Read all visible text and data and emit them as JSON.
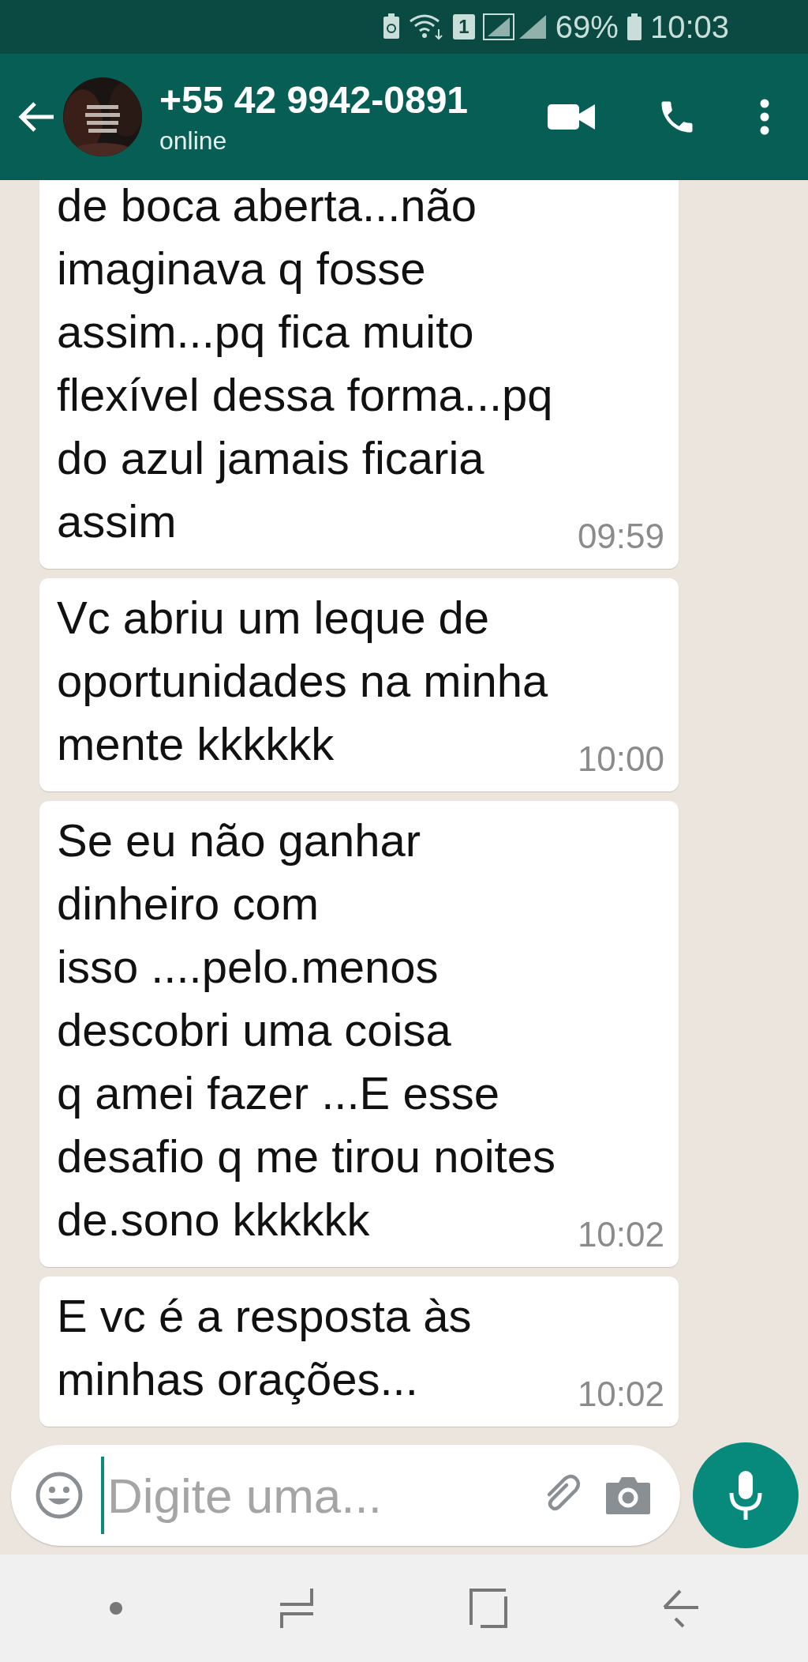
{
  "status_bar": {
    "sim_label": "1",
    "battery": "69%",
    "time": "10:03"
  },
  "header": {
    "contact": "+55 42 9942-0891",
    "presence": "online"
  },
  "messages": [
    {
      "kind": "continued",
      "text": "de boca aberta...não\nimaginava q fosse\nassim...pq fica muito\nflexível dessa forma...pq\ndo azul jamais ficaria\nassim",
      "time": "09:59"
    },
    {
      "kind": "full",
      "text": "Vc abriu um leque de\noportunidades na minha\nmente kkkkkk",
      "time": "10:00"
    },
    {
      "kind": "full",
      "text": "Se eu não ganhar\ndinheiro com\nisso ....pelo.menos\ndescobri uma coisa\nq amei fazer ...E esse\ndesafio q me tirou noites\nde.sono kkkkkk",
      "time": "10:02"
    },
    {
      "kind": "full",
      "text": "E vc é a resposta às\nminhas orações...",
      "time": "10:02"
    }
  ],
  "composer": {
    "placeholder": "Digite uma..."
  }
}
